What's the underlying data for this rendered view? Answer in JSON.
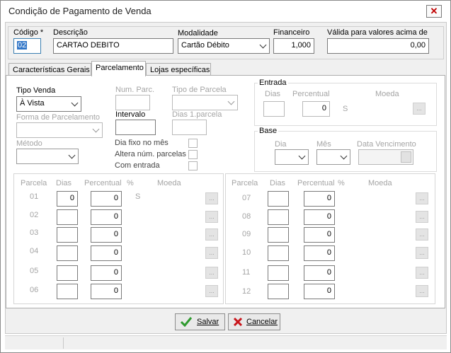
{
  "window": {
    "title": "Condição de Pagamento de Venda",
    "close_label": "✕"
  },
  "header": {
    "codigo": {
      "label": "Código *",
      "value": "02"
    },
    "descricao": {
      "label": "Descrição",
      "value": "CARTAO DEBITO"
    },
    "modalidade": {
      "label": "Modalidade",
      "value": "Cartão Débito"
    },
    "financeiro": {
      "label": "Financeiro",
      "value": "1,000"
    },
    "valida": {
      "label": "Válida para valores acima de",
      "value": "0,00"
    }
  },
  "tabs": [
    {
      "label": "Características Gerais"
    },
    {
      "label": "Parcelamento"
    },
    {
      "label": "Lojas específicas"
    }
  ],
  "parcelamento": {
    "tipo_venda": {
      "label": "Tipo Venda",
      "value": "À Vista"
    },
    "forma_parcelamento": {
      "label": "Forma de Parcelamento",
      "value": ""
    },
    "metodo": {
      "label": "Método",
      "value": ""
    },
    "num_parc": {
      "label": "Num. Parc.",
      "value": ""
    },
    "tipo_parcela": {
      "label": "Tipo de Parcela",
      "value": ""
    },
    "intervalo": {
      "label": "Intervalo",
      "value": ""
    },
    "dias_1_parcela": {
      "label": "Dias 1.parcela",
      "value": ""
    },
    "dia_fixo": {
      "label": "Dia fixo no mês"
    },
    "altera_num": {
      "label": "Altera núm. parcelas"
    },
    "com_entrada": {
      "label": "Com entrada"
    },
    "entrada": {
      "title": "Entrada",
      "dias_label": "Dias",
      "dias_value": "",
      "percentual_label": "Percentual",
      "percentual_value": "0",
      "symbol": "S",
      "moeda_label": "Moeda",
      "ellipsis": "..."
    },
    "base": {
      "title": "Base",
      "dia_label": "Dia",
      "dia_value": "",
      "mes_label": "Mês",
      "mes_value": "",
      "data_venc_label": "Data Vencimento",
      "data_venc_value": ""
    }
  },
  "grid_headers": {
    "parcela": "Parcela",
    "dias": "Dias",
    "percentual": "Percentual",
    "pct": "%",
    "moeda": "Moeda"
  },
  "parcelas_left": [
    {
      "num": "01",
      "dias": "0",
      "pct": "0",
      "sym": "S"
    },
    {
      "num": "02",
      "dias": "",
      "pct": "0",
      "sym": ""
    },
    {
      "num": "03",
      "dias": "",
      "pct": "0",
      "sym": ""
    },
    {
      "num": "04",
      "dias": "",
      "pct": "0",
      "sym": ""
    },
    {
      "num": "05",
      "dias": "",
      "pct": "0",
      "sym": ""
    },
    {
      "num": "06",
      "dias": "",
      "pct": "0",
      "sym": ""
    }
  ],
  "parcelas_right": [
    {
      "num": "07",
      "dias": "",
      "pct": "0"
    },
    {
      "num": "08",
      "dias": "",
      "pct": "0"
    },
    {
      "num": "09",
      "dias": "",
      "pct": "0"
    },
    {
      "num": "10",
      "dias": "",
      "pct": "0"
    },
    {
      "num": "11",
      "dias": "",
      "pct": "0"
    },
    {
      "num": "12",
      "dias": "",
      "pct": "0"
    }
  ],
  "ellipsis": "...",
  "buttons": {
    "salvar": "Salvar",
    "cancelar": "Cancelar"
  },
  "colors": {
    "check_green": "#2e9a2e",
    "cancel_red": "#c8151b"
  }
}
